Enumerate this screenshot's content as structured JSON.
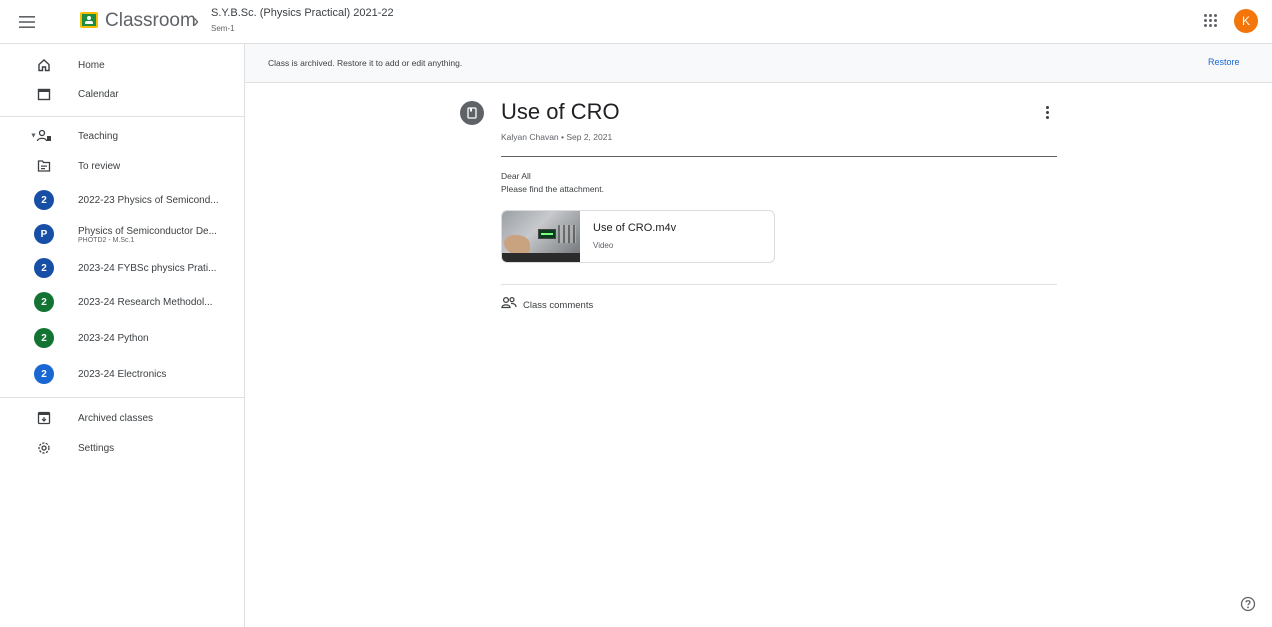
{
  "header": {
    "app_name": "Classroom",
    "breadcrumb_separator": "›",
    "class_title": "S.Y.B.Sc. (Physics Practical) 2021-22",
    "class_section": "Sem-1",
    "avatar_initial": "K"
  },
  "sidebar": {
    "home": "Home",
    "calendar": "Calendar",
    "teaching": "Teaching",
    "to_review": "To review",
    "classes": [
      {
        "badge": "2",
        "label": "2022-23 Physics of Semicond...",
        "color": "#174ea6"
      },
      {
        "badge": "P",
        "label": "Physics of Semiconductor De...",
        "sub": "PHOTD2 - M.Sc.1",
        "color": "#174ea6"
      },
      {
        "badge": "2",
        "label": "2023-24 FYBSc physics Prati...",
        "color": "#174ea6"
      },
      {
        "badge": "2",
        "label": "2023-24 Research Methodol...",
        "color": "#137333"
      },
      {
        "badge": "2",
        "label": "2023-24 Python",
        "color": "#137333"
      },
      {
        "badge": "2",
        "label": "2023-24 Electronics",
        "color": "#1967d2"
      }
    ],
    "archived": "Archived classes",
    "settings": "Settings"
  },
  "banner": {
    "text": "Class is archived. Restore it to add or edit anything.",
    "action": "Restore"
  },
  "post": {
    "title": "Use of CRO",
    "meta": "Kalyan Chavan • Sep 2, 2021",
    "body_line1": "Dear All",
    "body_line2": "Please find the attachment.",
    "attachment": {
      "name": "Use of CRO.m4v",
      "type": "Video"
    },
    "comments_label": "Class comments"
  },
  "colors": {
    "accent": "#1967d2",
    "avatar": "#f4760b",
    "logo_green": "#1e8e3e",
    "logo_yellow": "#fbbc04"
  }
}
